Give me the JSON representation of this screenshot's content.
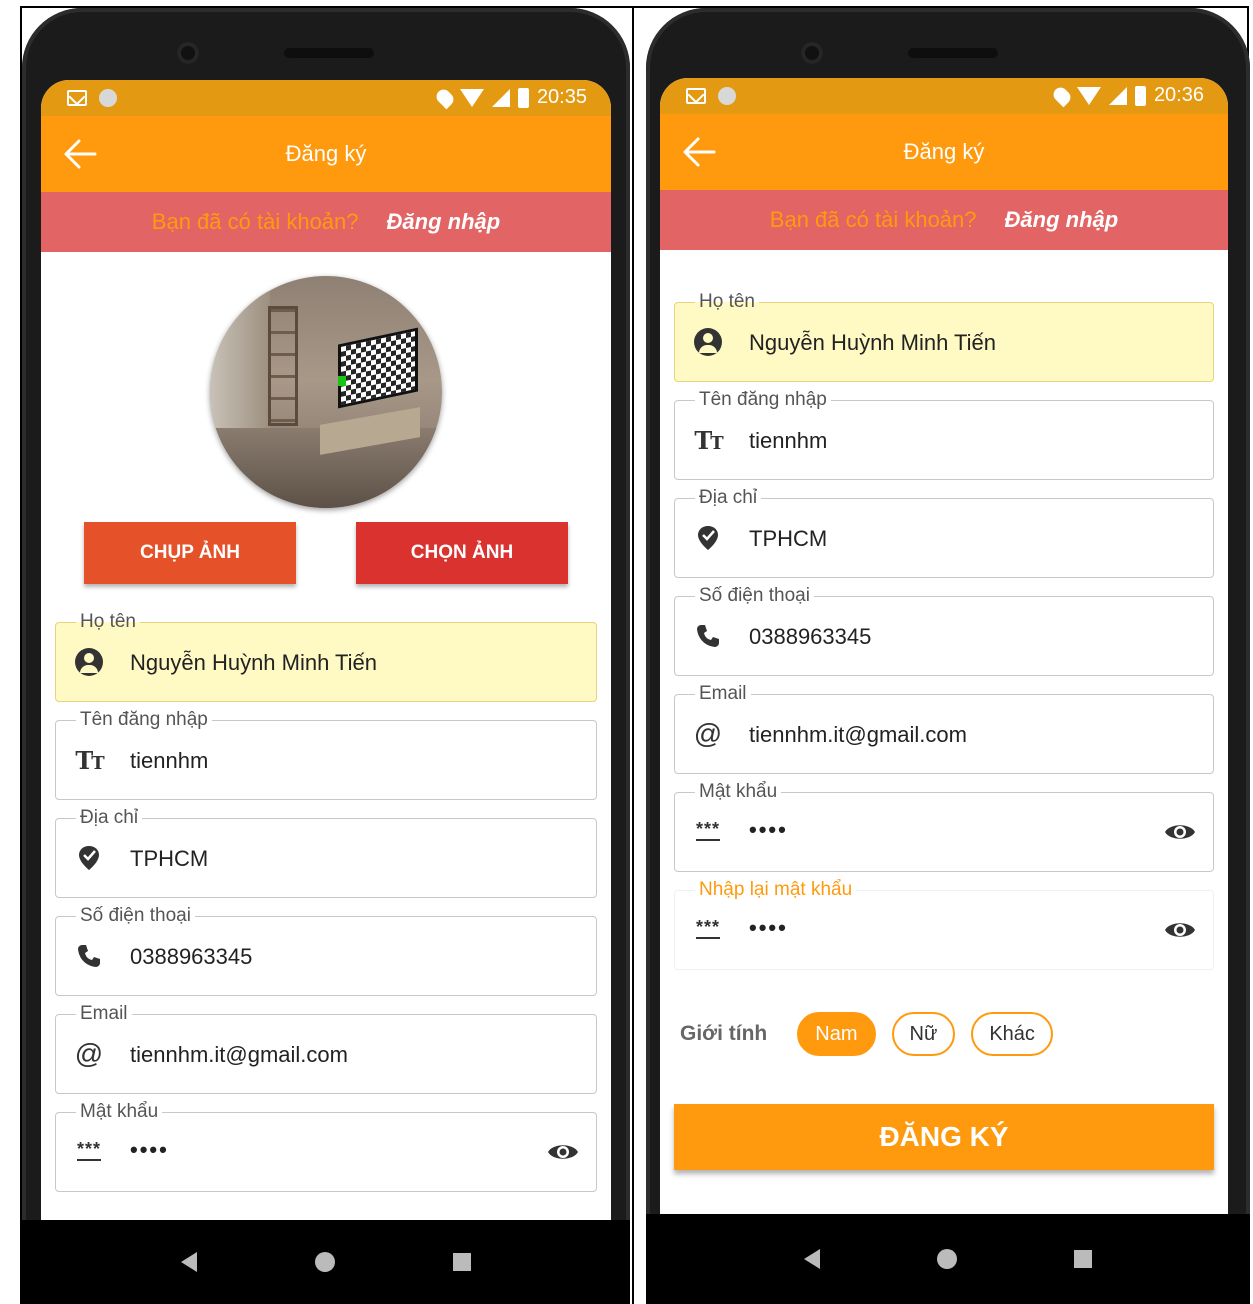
{
  "screens": [
    {
      "status": {
        "time": "20:35"
      },
      "appbar": {
        "title": "Đăng ký"
      },
      "login_prompt": {
        "question": "Bạn đã có tài khoản?",
        "link": "Đăng nhập"
      },
      "photo_buttons": {
        "capture": "CHỤP ẢNH",
        "choose": "CHỌN ẢNH"
      },
      "fields": {
        "fullname": {
          "label": "Họ tên",
          "value": "Nguyễn Huỳnh Minh Tiến"
        },
        "username": {
          "label": "Tên đăng nhập",
          "value": "tiennhm"
        },
        "address": {
          "label": "Địa chỉ",
          "value": "TPHCM"
        },
        "phone": {
          "label": "Số điện thoại",
          "value": "0388963345"
        },
        "email": {
          "label": "Email",
          "value": "tiennhm.it@gmail.com"
        },
        "password": {
          "label": "Mật khẩu",
          "value": "••••"
        }
      }
    },
    {
      "status": {
        "time": "20:36"
      },
      "appbar": {
        "title": "Đăng ký"
      },
      "login_prompt": {
        "question": "Bạn đã có tài khoản?",
        "link": "Đăng nhập"
      },
      "fields": {
        "fullname": {
          "label": "Họ tên",
          "value": "Nguyễn Huỳnh Minh Tiến"
        },
        "username": {
          "label": "Tên đăng nhập",
          "value": "tiennhm"
        },
        "address": {
          "label": "Địa chỉ",
          "value": "TPHCM"
        },
        "phone": {
          "label": "Số điện thoại",
          "value": "0388963345"
        },
        "email": {
          "label": "Email",
          "value": "tiennhm.it@gmail.com"
        },
        "password": {
          "label": "Mật khẩu",
          "value": "••••"
        },
        "confirm_password": {
          "label": "Nhập lại mật khẩu",
          "value": "••••"
        }
      },
      "gender": {
        "label": "Giới tính",
        "options": [
          "Nam",
          "Nữ",
          "Khác"
        ],
        "selected": "Nam"
      },
      "register_button": "ĐĂNG KÝ"
    }
  ],
  "icons": {
    "pw_glyph": "***",
    "tt_big": "T",
    "tt_small": "T",
    "at": "@",
    "phone": "✆",
    "map": "⬢"
  },
  "colors": {
    "accent": "#ff9a0f",
    "login_bar": "#e36464",
    "capture_button": "#e5522a",
    "choose_button": "#d9322f",
    "highlight_field": "#fff9c4"
  }
}
